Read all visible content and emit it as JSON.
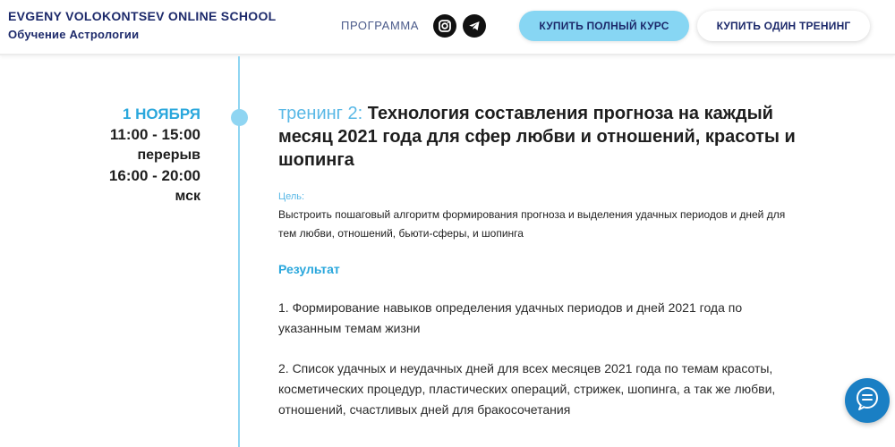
{
  "header": {
    "brand_name": "EVGENY VOLOKONTSEV ONLINE SCHOOL",
    "brand_subtitle": "Обучение Астрологии",
    "nav_program": "ПРОГРАММА",
    "buy_full_course": "КУПИТЬ ПОЛНЫЙ КУРС",
    "buy_one_training": "КУПИТЬ ОДИН ТРЕНИНГ",
    "social_icons": [
      "instagram-icon",
      "telegram-icon"
    ]
  },
  "schedule": {
    "date": "1 НОЯБРЯ",
    "time1": "11:00 - 15:00",
    "break": "перерыв",
    "time2": "16:00 - 20:00",
    "tz": "мск"
  },
  "training": {
    "prefix": "тренинг 2:",
    "title": "Технология составления прогноза на каждый месяц 2021 года для сфер любви и отношений, красоты и шопинга",
    "goal_label": "Цель:",
    "goal_text": "Выстроить пошаговый алгоритм формирования прогноза и выделения удачных периодов и дней для тем любви, отношений, бьюти-сферы, и шопинга",
    "result_heading": "Результат",
    "results": [
      "1. Формирование навыков определения удачных периодов и дней 2021 года по указанным темам жизни",
      "2. Список удачных и неудачных дней для всех месяцев 2021 года по темам красоты, косметических процедур, пластических операций, стрижек, шопинга, а так же любви, отношений, счастливых дней для бракосочетания"
    ]
  },
  "colors": {
    "accent": "#59b8e6",
    "accent_strong": "#2aa7dc",
    "button_full_bg": "#87d6f3",
    "brand_text": "#1d2a6b",
    "chat_button": "#1a7fc4"
  },
  "widgets": {
    "chat_icon": "chat-bubble-icon"
  }
}
